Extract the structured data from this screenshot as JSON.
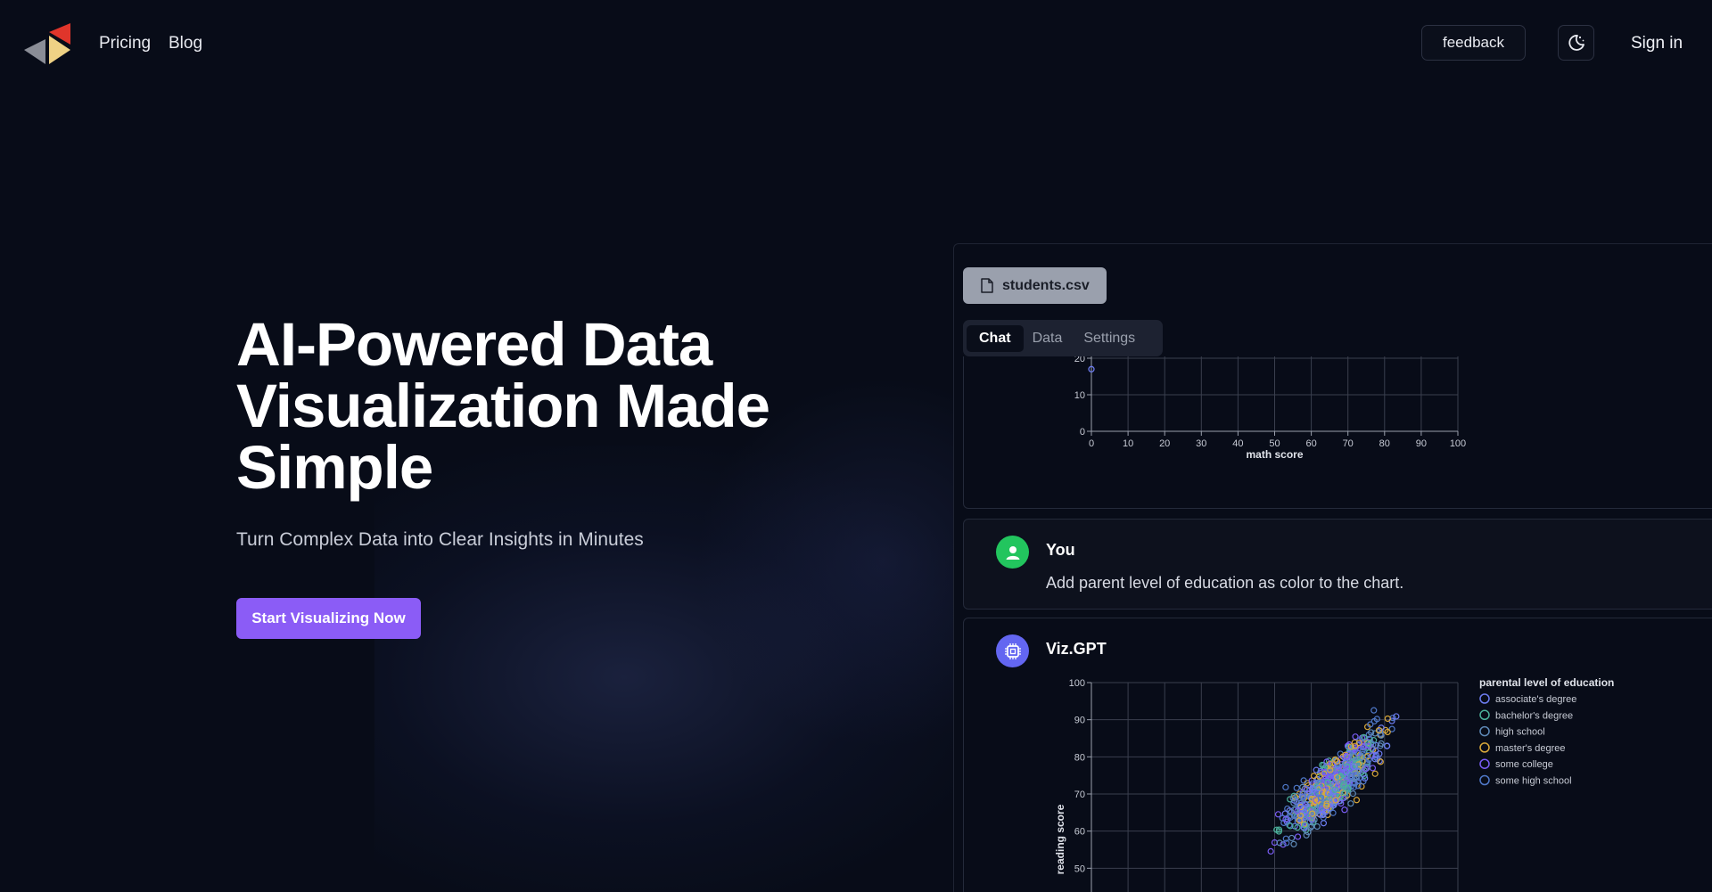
{
  "nav": {
    "links": [
      "Pricing",
      "Blog"
    ],
    "feedback_label": "feedback",
    "signin_label": "Sign in",
    "logo_colors": {
      "red": "#e0352b",
      "yellow": "#efd285",
      "gray": "#8a8d96"
    }
  },
  "hero": {
    "title": "AI-Powered Data Visualization Made Simple",
    "subtitle": "Turn Complex Data into Clear Insights in Minutes",
    "cta_label": "Start Visualizing Now",
    "cta_color": "#8b5cf6"
  },
  "panel": {
    "file_name": "students.csv",
    "tabs": [
      {
        "label": "Chat",
        "active": true
      },
      {
        "label": "Data",
        "active": false
      },
      {
        "label": "Settings",
        "active": false
      }
    ],
    "messages": [
      {
        "author": "You",
        "text": "Add parent level of education as color to the chart.",
        "avatar_color": "#22c55e"
      },
      {
        "author": "Viz.GPT",
        "avatar_color": "#6366f1"
      }
    ]
  },
  "chart_data": [
    {
      "type": "scatter",
      "xlabel": "math score",
      "ylabel": "",
      "xlim": [
        0,
        100
      ],
      "x_ticks": [
        0,
        10,
        20,
        30,
        40,
        50,
        60,
        70,
        80,
        90,
        100
      ],
      "y_ticks": [
        0,
        10,
        20
      ],
      "points": [
        [
          0,
          17
        ]
      ],
      "grid": true
    },
    {
      "type": "scatter",
      "xlabel": "",
      "ylabel": "reading score",
      "xlim": [
        0,
        100
      ],
      "ylim": [
        40,
        100
      ],
      "y_ticks": [
        50,
        60,
        70,
        80,
        90,
        100
      ],
      "grid": true,
      "legend_title": "parental level of education",
      "legend_position": "right",
      "series": [
        {
          "name": "associate's degree",
          "color": "#6d7cf0"
        },
        {
          "name": "bachelor's degree",
          "color": "#4bb09a"
        },
        {
          "name": "high school",
          "color": "#5e8ab8"
        },
        {
          "name": "master's degree",
          "color": "#d9a83a"
        },
        {
          "name": "some college",
          "color": "#7a5cf5"
        },
        {
          "name": "some high school",
          "color": "#4f78c8"
        }
      ],
      "trend": {
        "x_range": [
          22,
          100
        ],
        "slope": 0.85,
        "intercept": 17
      }
    }
  ]
}
